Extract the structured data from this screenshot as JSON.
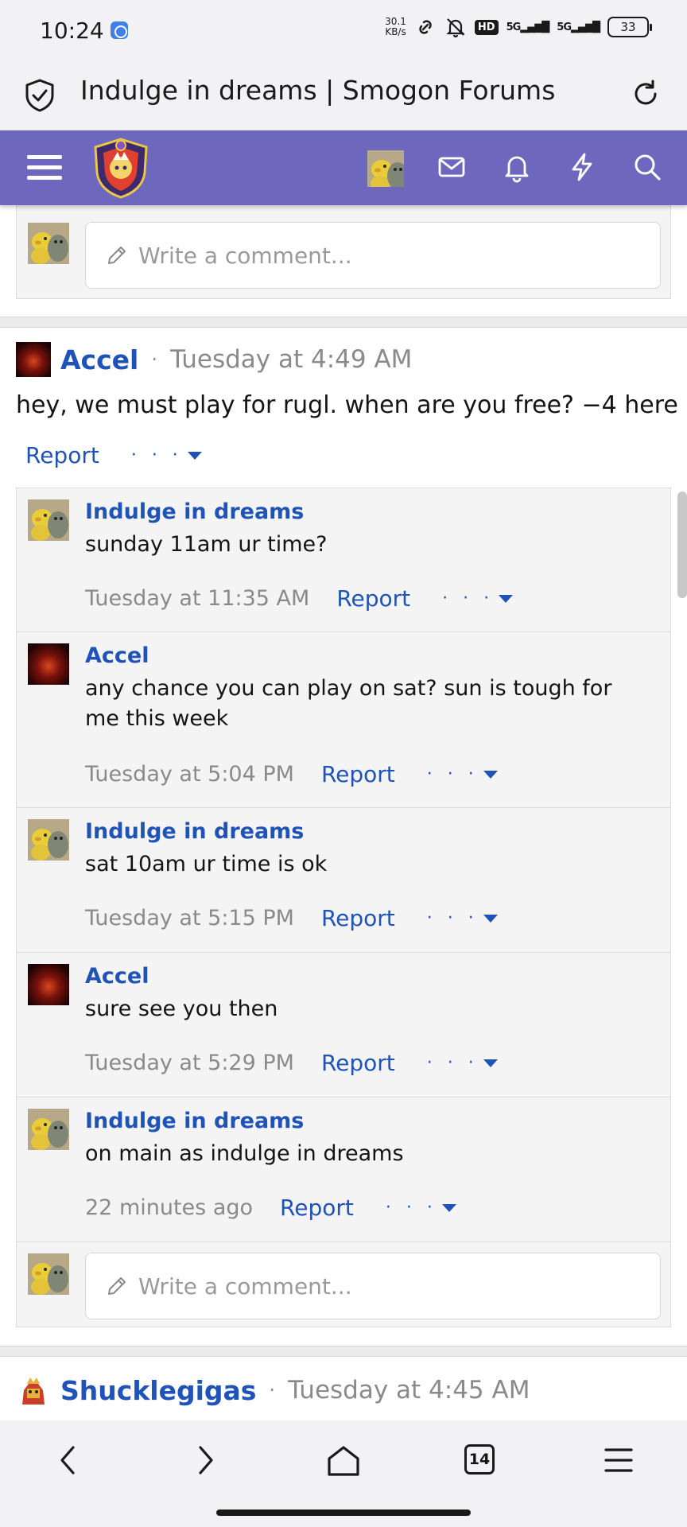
{
  "status_bar": {
    "time": "10:24",
    "net_speed_value": "30.1",
    "net_speed_unit": "KB/s",
    "hd_label": "HD",
    "signal1_label": "5G",
    "signal2_label": "5G",
    "battery": "33"
  },
  "browser": {
    "page_title": "Indulge in dreams | Smogon Forums",
    "open_tabs": "14"
  },
  "forum_nav": {
    "brand_color": "#6d68bd"
  },
  "top_comment_box": {
    "placeholder": "Write a comment..."
  },
  "profile_post": {
    "author": "Accel",
    "separator": "·",
    "date": "Tuesday at 4:49 AM",
    "body": "hey, we must play for rugl. when are you free? −4 here",
    "report_label": "Report",
    "more_label": "· · ·"
  },
  "replies": [
    {
      "author": "Indulge in dreams",
      "text": "sunday 11am ur time?",
      "time": "Tuesday at 11:35 AM",
      "report_label": "Report",
      "more_label": "· · ·"
    },
    {
      "author": "Accel",
      "text": "any chance you can play on sat? sun is tough for me this week",
      "time": "Tuesday at 5:04 PM",
      "report_label": "Report",
      "more_label": "· · ·"
    },
    {
      "author": "Indulge in dreams",
      "text": "sat 10am ur time is ok",
      "time": "Tuesday at 5:15 PM",
      "report_label": "Report",
      "more_label": "· · ·"
    },
    {
      "author": "Accel",
      "text": "sure see you then",
      "time": "Tuesday at 5:29 PM",
      "report_label": "Report",
      "more_label": "· · ·"
    },
    {
      "author": "Indulge in dreams",
      "text": "on main as indulge in dreams",
      "time": "22 minutes ago",
      "report_label": "Report",
      "more_label": "· · ·"
    }
  ],
  "reply_comment_box": {
    "placeholder": "Write a comment..."
  },
  "next_post": {
    "author": "Shucklegigas",
    "separator": "·",
    "date": "Tuesday at 4:45 AM"
  }
}
